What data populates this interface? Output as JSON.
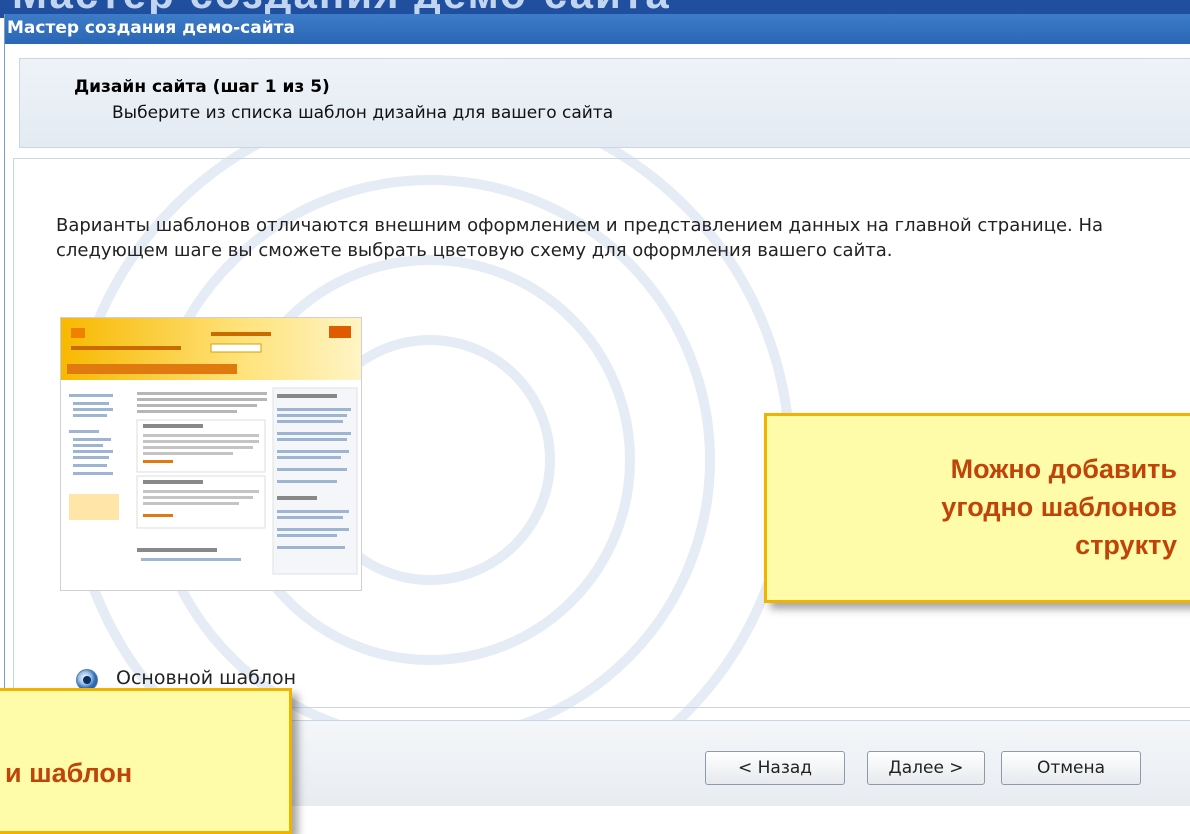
{
  "slide": {
    "heading": "Мастер создания демо-сайта"
  },
  "window": {
    "title": "Мастер создания демо-сайта"
  },
  "header": {
    "title": "Дизайн сайта (шаг 1 из 5)",
    "subtitle": "Выберите из списка шаблон дизайна для вашего сайта"
  },
  "content": {
    "description": "Варианты шаблонов отличаются внешним оформлением и представлением данных на главной странице. На следующем шаге вы сможете выбрать цветовую схему для оформления вашего сайта.",
    "template_option": {
      "label": "Основной шаблон",
      "selected": true
    }
  },
  "buttons": {
    "back": "< Назад",
    "next": "Далее >",
    "cancel": "Отмена"
  },
  "callouts": {
    "right_line1": "Можно добавить",
    "right_line2": "угодно шаблонов",
    "right_line3": "структу",
    "left_text": "и шаблон"
  },
  "colors": {
    "title_bar": "#2a66b5",
    "callout_bg": "#fefca8",
    "callout_border": "#f0b400",
    "callout_text": "#c0440a"
  }
}
